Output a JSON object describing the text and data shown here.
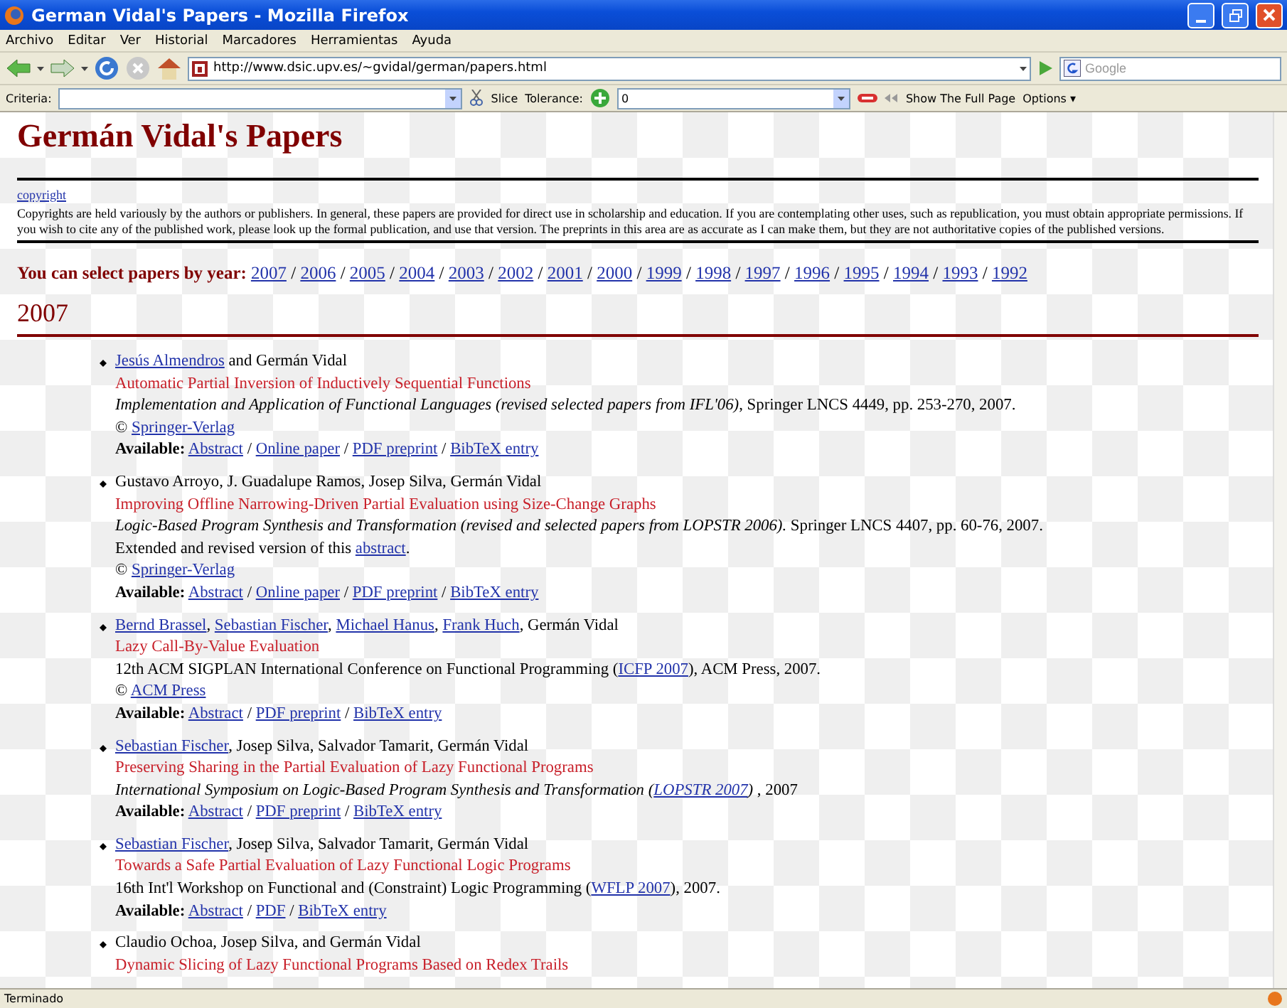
{
  "window": {
    "title": "German Vidal's Papers - Mozilla Firefox"
  },
  "menu": [
    "Archivo",
    "Editar",
    "Ver",
    "Historial",
    "Marcadores",
    "Herramientas",
    "Ayuda"
  ],
  "navigation": {
    "url": "http://www.dsic.upv.es/~gvidal/german/papers.html",
    "search_placeholder": "Google"
  },
  "slice_toolbar": {
    "criteria_label": "Criteria:",
    "slice_label": "Slice",
    "tolerance_label": "Tolerance:",
    "tolerance_value": "0",
    "full_page_label": "Show The Full Page",
    "options_label": "Options ▾"
  },
  "page": {
    "heading": "Germán Vidal's Papers",
    "copyright_link": "copyright",
    "copyright_text": "Copyrights are held variously by the authors or publishers. In general, these papers are provided for direct use in scholarship and education. If you are contemplating other uses, such as republication, you must obtain appropriate permissions. If you wish to cite any of the published work, please look up the formal publication, and use that version. The preprints in this area are as accurate as I can make them, but they are not authoritative copies of the published versions.",
    "year_nav": {
      "label": "You can select papers by year:",
      "separator": "/",
      "years": [
        "2007",
        "2006",
        "2005",
        "2004",
        "2003",
        "2002",
        "2001",
        "2000",
        "1999",
        "1998",
        "1997",
        "1996",
        "1995",
        "1994",
        "1993",
        "1992"
      ]
    },
    "section": {
      "year": "2007",
      "papers": [
        {
          "authors": [
            {
              "text": "Jesús Almendros",
              "kind": "link"
            },
            {
              "text": " and Germán Vidal",
              "kind": "plain"
            }
          ],
          "title": "Automatic Partial Inversion of Inductively Sequential Functions",
          "lines": [
            [
              {
                "text": "Implementation and Application of Functional Languages (revised selected papers from IFL'06)",
                "kind": "italic"
              },
              {
                "text": ", Springer LNCS 4449, pp. 253-270, 2007.",
                "kind": "plain"
              }
            ],
            [
              {
                "text": "© ",
                "kind": "plain"
              },
              {
                "text": "Springer-Verlag",
                "kind": "link"
              }
            ]
          ],
          "available": {
            "label": "Available:",
            "separator": "/",
            "links": [
              "Abstract",
              "Online paper",
              "PDF preprint",
              "BibTeX entry"
            ]
          }
        },
        {
          "authors": [
            {
              "text": "Gustavo Arroyo, J. Guadalupe Ramos, Josep Silva, Germán Vidal",
              "kind": "plain"
            }
          ],
          "title": "Improving Offline Narrowing-Driven Partial Evaluation using Size-Change Graphs",
          "lines": [
            [
              {
                "text": "Logic-Based Program Synthesis and Transformation (revised and selected papers from LOPSTR 2006).",
                "kind": "italic"
              },
              {
                "text": " Springer LNCS 4407, pp. 60-76, 2007.",
                "kind": "plain"
              }
            ],
            [
              {
                "text": "Extended and revised version of this ",
                "kind": "plain"
              },
              {
                "text": "abstract",
                "kind": "link"
              },
              {
                "text": ".",
                "kind": "plain"
              }
            ],
            [
              {
                "text": "© ",
                "kind": "plain"
              },
              {
                "text": "Springer-Verlag",
                "kind": "link"
              }
            ]
          ],
          "available": {
            "label": "Available:",
            "separator": "/",
            "links": [
              "Abstract",
              "Online paper",
              "PDF preprint",
              "BibTeX entry"
            ]
          }
        },
        {
          "authors": [
            {
              "text": "Bernd Brassel",
              "kind": "link"
            },
            {
              "text": ", ",
              "kind": "plain"
            },
            {
              "text": "Sebastian Fischer",
              "kind": "link"
            },
            {
              "text": ", ",
              "kind": "plain"
            },
            {
              "text": "Michael Hanus",
              "kind": "link"
            },
            {
              "text": ", ",
              "kind": "plain"
            },
            {
              "text": "Frank Huch",
              "kind": "link"
            },
            {
              "text": ", Germán Vidal",
              "kind": "plain"
            }
          ],
          "title": "Lazy Call-By-Value Evaluation",
          "lines": [
            [
              {
                "text": "12th ACM SIGPLAN International Conference on Functional Programming (",
                "kind": "plain"
              },
              {
                "text": "ICFP 2007",
                "kind": "link"
              },
              {
                "text": "), ACM Press, 2007.",
                "kind": "plain"
              }
            ],
            [
              {
                "text": "© ",
                "kind": "plain"
              },
              {
                "text": "ACM Press",
                "kind": "link"
              }
            ]
          ],
          "available": {
            "label": "Available:",
            "separator": "/",
            "links": [
              "Abstract",
              "PDF preprint",
              "BibTeX entry"
            ]
          }
        },
        {
          "authors": [
            {
              "text": "Sebastian Fischer",
              "kind": "link"
            },
            {
              "text": ", Josep Silva, Salvador Tamarit, Germán Vidal",
              "kind": "plain"
            }
          ],
          "title": "Preserving Sharing in the Partial Evaluation of Lazy Functional Programs",
          "lines": [
            [
              {
                "text": "International Symposium on Logic-Based Program Synthesis and Transformation (",
                "kind": "italic"
              },
              {
                "text": "LOPSTR 2007",
                "kind": "italic-link"
              },
              {
                "text": ")",
                "kind": "italic"
              },
              {
                "text": " , 2007",
                "kind": "plain"
              }
            ]
          ],
          "available": {
            "label": "Available:",
            "separator": "/",
            "links": [
              "Abstract",
              "PDF preprint",
              "BibTeX entry"
            ]
          }
        },
        {
          "authors": [
            {
              "text": "Sebastian Fischer",
              "kind": "link"
            },
            {
              "text": ", Josep Silva, Salvador Tamarit, Germán Vidal",
              "kind": "plain"
            }
          ],
          "title": "Towards a Safe Partial Evaluation of Lazy Functional Logic Programs",
          "lines": [
            [
              {
                "text": "16th Int'l Workshop on Functional and (Constraint) Logic Programming (",
                "kind": "plain"
              },
              {
                "text": "WFLP 2007",
                "kind": "link"
              },
              {
                "text": "), 2007.",
                "kind": "plain"
              }
            ]
          ],
          "available": {
            "label": "Available:",
            "separator": "/",
            "links": [
              "Abstract",
              "PDF",
              "BibTeX entry"
            ]
          }
        },
        {
          "authors": [
            {
              "text": "Claudio Ochoa, Josep Silva, and Germán Vidal",
              "kind": "plain"
            }
          ],
          "title": "Dynamic Slicing of Lazy Functional Programs Based on Redex Trails"
        }
      ]
    }
  },
  "status_bar": {
    "text": "Terminado"
  }
}
